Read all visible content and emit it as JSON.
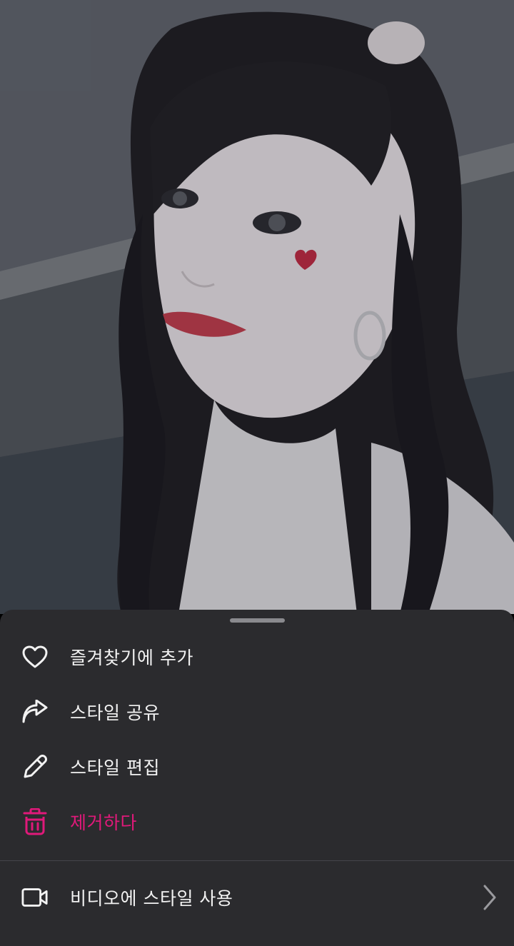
{
  "photo": {
    "icon": "portrait-photo"
  },
  "sheet": {
    "items": [
      {
        "label": "즐겨찾기에 추가",
        "icon": "heart-icon"
      },
      {
        "label": "스타일 공유",
        "icon": "share-arrow-icon"
      },
      {
        "label": "스타일 편집",
        "icon": "pencil-icon"
      },
      {
        "label": "제거하다",
        "icon": "trash-icon"
      }
    ],
    "video": {
      "label": "비디오에 스타일 사용",
      "icon": "video-camera-icon"
    }
  },
  "colors": {
    "sheet_bg": "#2b2b2e",
    "text": "#f2f2f2",
    "danger": "#e0197a"
  }
}
